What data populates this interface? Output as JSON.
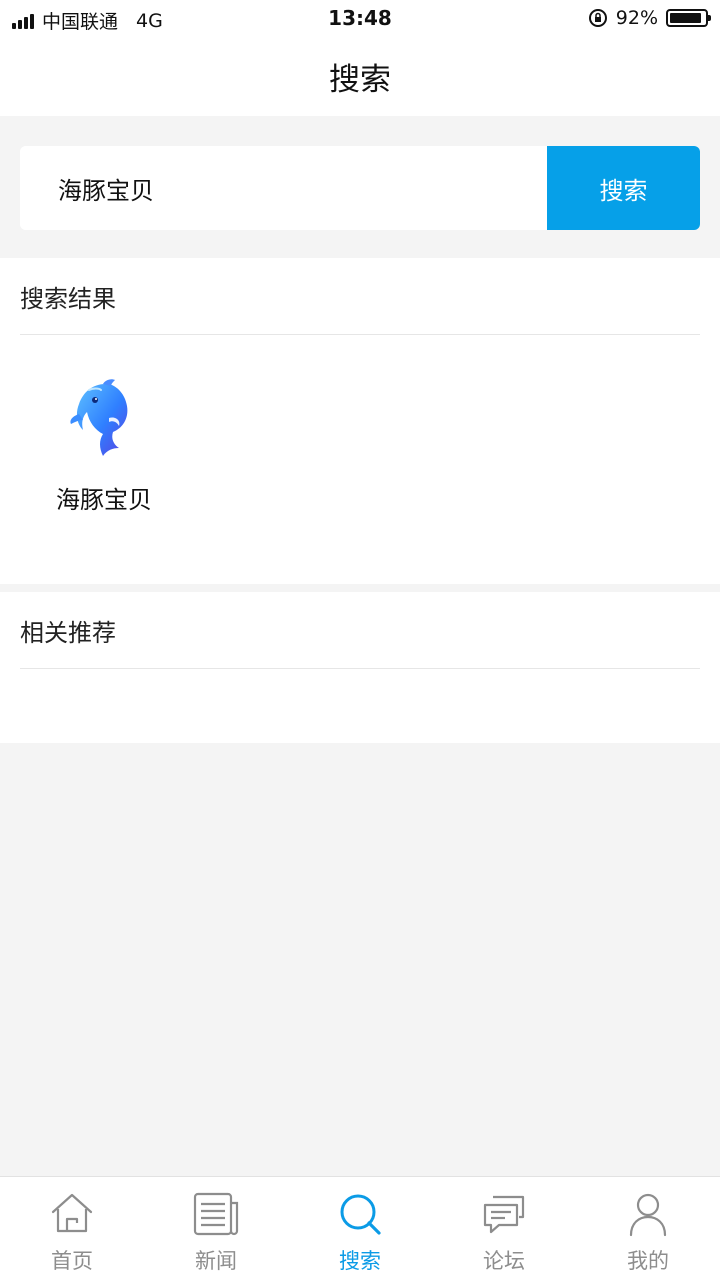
{
  "status_bar": {
    "carrier": "中国联通",
    "network": "4G",
    "time": "13:48",
    "battery_percent": "92%",
    "battery_level": 0.92
  },
  "nav": {
    "title": "搜索"
  },
  "search": {
    "value": "海豚宝贝",
    "button_label": "搜索"
  },
  "results": {
    "heading": "搜索结果",
    "items": [
      {
        "label": "海豚宝贝",
        "icon": "dolphin-app-icon"
      }
    ]
  },
  "recommend": {
    "heading": "相关推荐"
  },
  "tabs": [
    {
      "label": "首页",
      "icon": "home-icon",
      "active": false
    },
    {
      "label": "新闻",
      "icon": "newspaper-icon",
      "active": false
    },
    {
      "label": "搜索",
      "icon": "search-icon",
      "active": true
    },
    {
      "label": "论坛",
      "icon": "chat-icon",
      "active": false
    },
    {
      "label": "我的",
      "icon": "user-icon",
      "active": false
    }
  ],
  "colors": {
    "accent": "#06a0e8",
    "tab_active": "#0b9be6",
    "tab_inactive": "#8d8d8d",
    "background": "#f4f4f4"
  }
}
